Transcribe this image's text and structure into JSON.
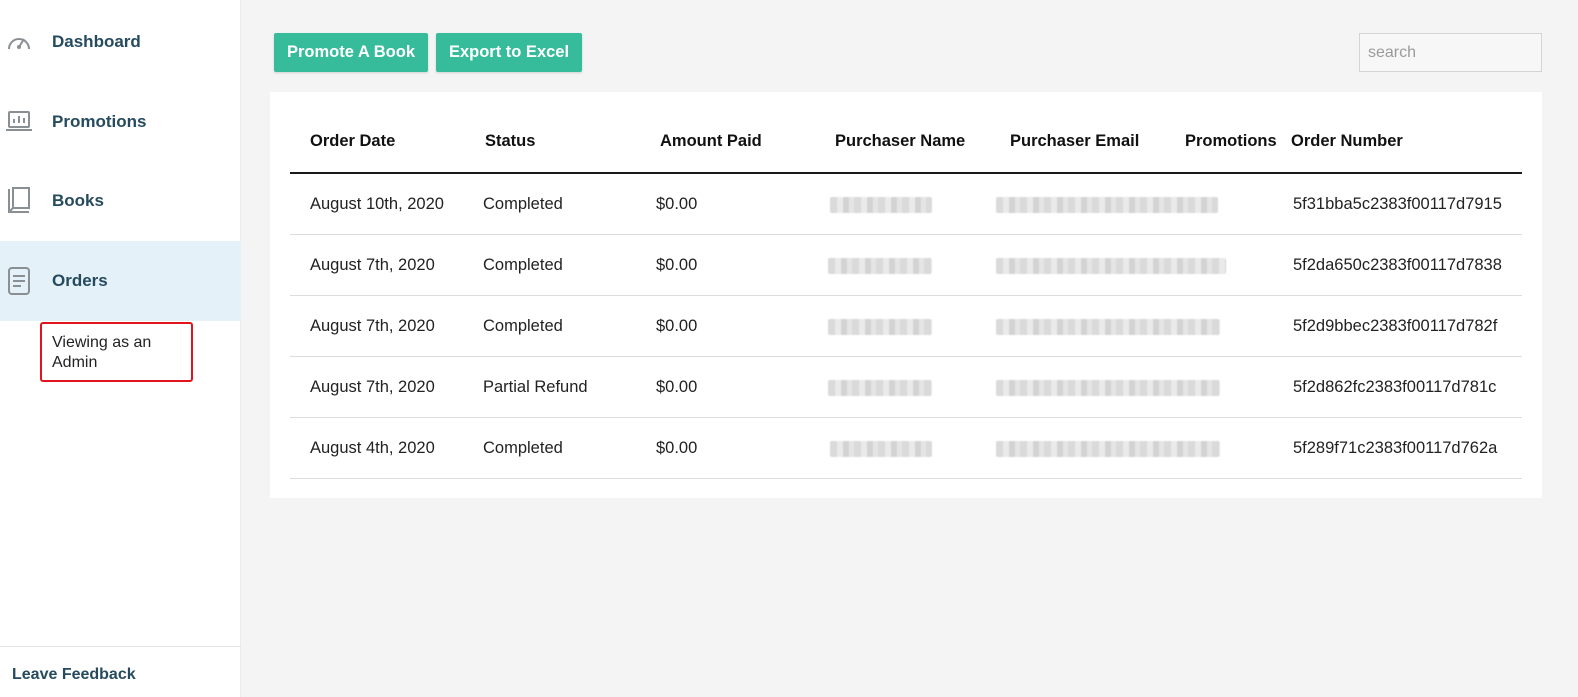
{
  "sidebar": {
    "items": [
      {
        "label": "Dashboard",
        "icon": "speedometer-icon",
        "active": false
      },
      {
        "label": "Promotions",
        "icon": "laptop-chart-icon",
        "active": false
      },
      {
        "label": "Books",
        "icon": "book-icon",
        "active": false
      },
      {
        "label": "Orders",
        "icon": "document-icon",
        "active": true
      }
    ],
    "admin_notice": "Viewing as an Admin",
    "feedback_label": "Leave Feedback"
  },
  "toolbar": {
    "promote_label": "Promote A Book",
    "export_label": "Export to Excel",
    "search_placeholder": "search",
    "accent_color": "#37bc9b"
  },
  "table": {
    "columns": [
      "Order Date",
      "Status",
      "Amount Paid",
      "Purchaser Name",
      "Purchaser Email",
      "Promotions",
      "Order Number"
    ],
    "rows": [
      {
        "date": "August 10th, 2020",
        "status": "Completed",
        "amount": "$0.00",
        "order_number": "5f31bba5c2383f00117d7915"
      },
      {
        "date": "August 7th, 2020",
        "status": "Completed",
        "amount": "$0.00",
        "order_number": "5f2da650c2383f00117d7838"
      },
      {
        "date": "August 7th, 2020",
        "status": "Completed",
        "amount": "$0.00",
        "order_number": "5f2d9bbec2383f00117d782f"
      },
      {
        "date": "August 7th, 2020",
        "status": "Partial Refund",
        "amount": "$0.00",
        "order_number": "5f2d862fc2383f00117d781c"
      },
      {
        "date": "August 4th, 2020",
        "status": "Completed",
        "amount": "$0.00",
        "order_number": "5f289f71c2383f00117d762a"
      }
    ]
  }
}
